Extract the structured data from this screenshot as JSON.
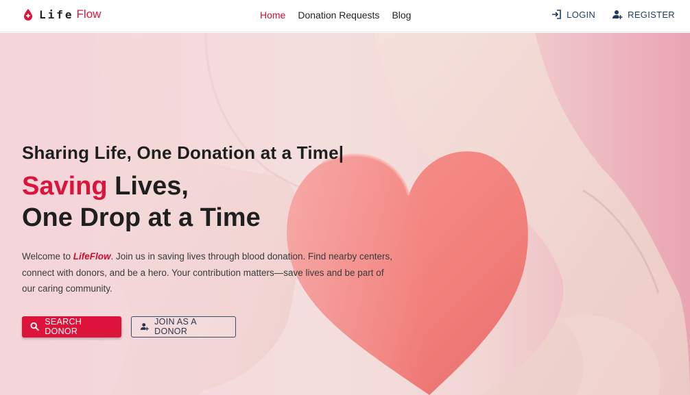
{
  "brand": {
    "name_part1": "Life",
    "name_part2": "Flow",
    "icon": "blood-drop-icon"
  },
  "nav": {
    "links": [
      {
        "label": "Home",
        "active": true
      },
      {
        "label": "Donation Requests",
        "active": false
      },
      {
        "label": "Blog",
        "active": false
      }
    ],
    "login_label": "LOGIN",
    "register_label": "REGISTER"
  },
  "hero": {
    "tagline": "Sharing Life, One Donation at a Time|",
    "headline_accent": "Saving",
    "headline_rest": " Lives,",
    "headline_line2": "One Drop at a Time",
    "description_prefix": "Welcome to ",
    "description_brand": "LifeFlow",
    "description_suffix": ". Join us in saving lives through blood donation. Find nearby centers, connect with donors, and be a hero. Your contribution matters—save lives and be part of our caring community.",
    "primary_button": "SEARCH DONOR",
    "secondary_button": "JOIN AS A DONOR"
  },
  "colors": {
    "accent": "#dc143c",
    "navy": "#1e3a5f",
    "heart": "#f47f7b"
  }
}
